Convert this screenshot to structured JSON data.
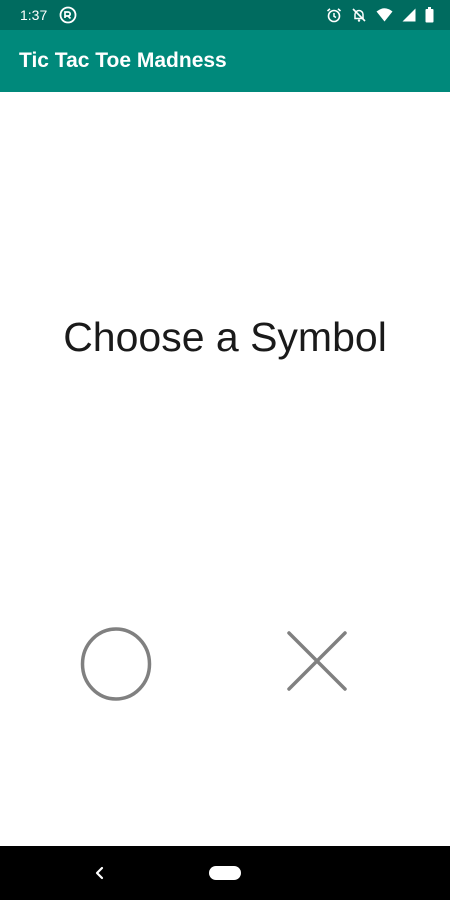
{
  "status_bar": {
    "time": "1:37",
    "icons": [
      "sync-icon",
      "alarm-icon",
      "notifications-off-icon",
      "wifi-icon",
      "signal-icon",
      "battery-icon"
    ]
  },
  "app_bar": {
    "title": "Tic Tac Toe Madness"
  },
  "main": {
    "heading": "Choose a Symbol",
    "symbols": [
      {
        "name": "circle-symbol-icon"
      },
      {
        "name": "cross-symbol-icon"
      }
    ]
  },
  "nav_bar": {
    "icons": [
      "back-icon",
      "home-pill-icon"
    ]
  },
  "colors": {
    "status_bar": "#006b5f",
    "app_bar": "#00897b",
    "symbol_stroke": "#808080",
    "nav_bar": "#000000"
  }
}
